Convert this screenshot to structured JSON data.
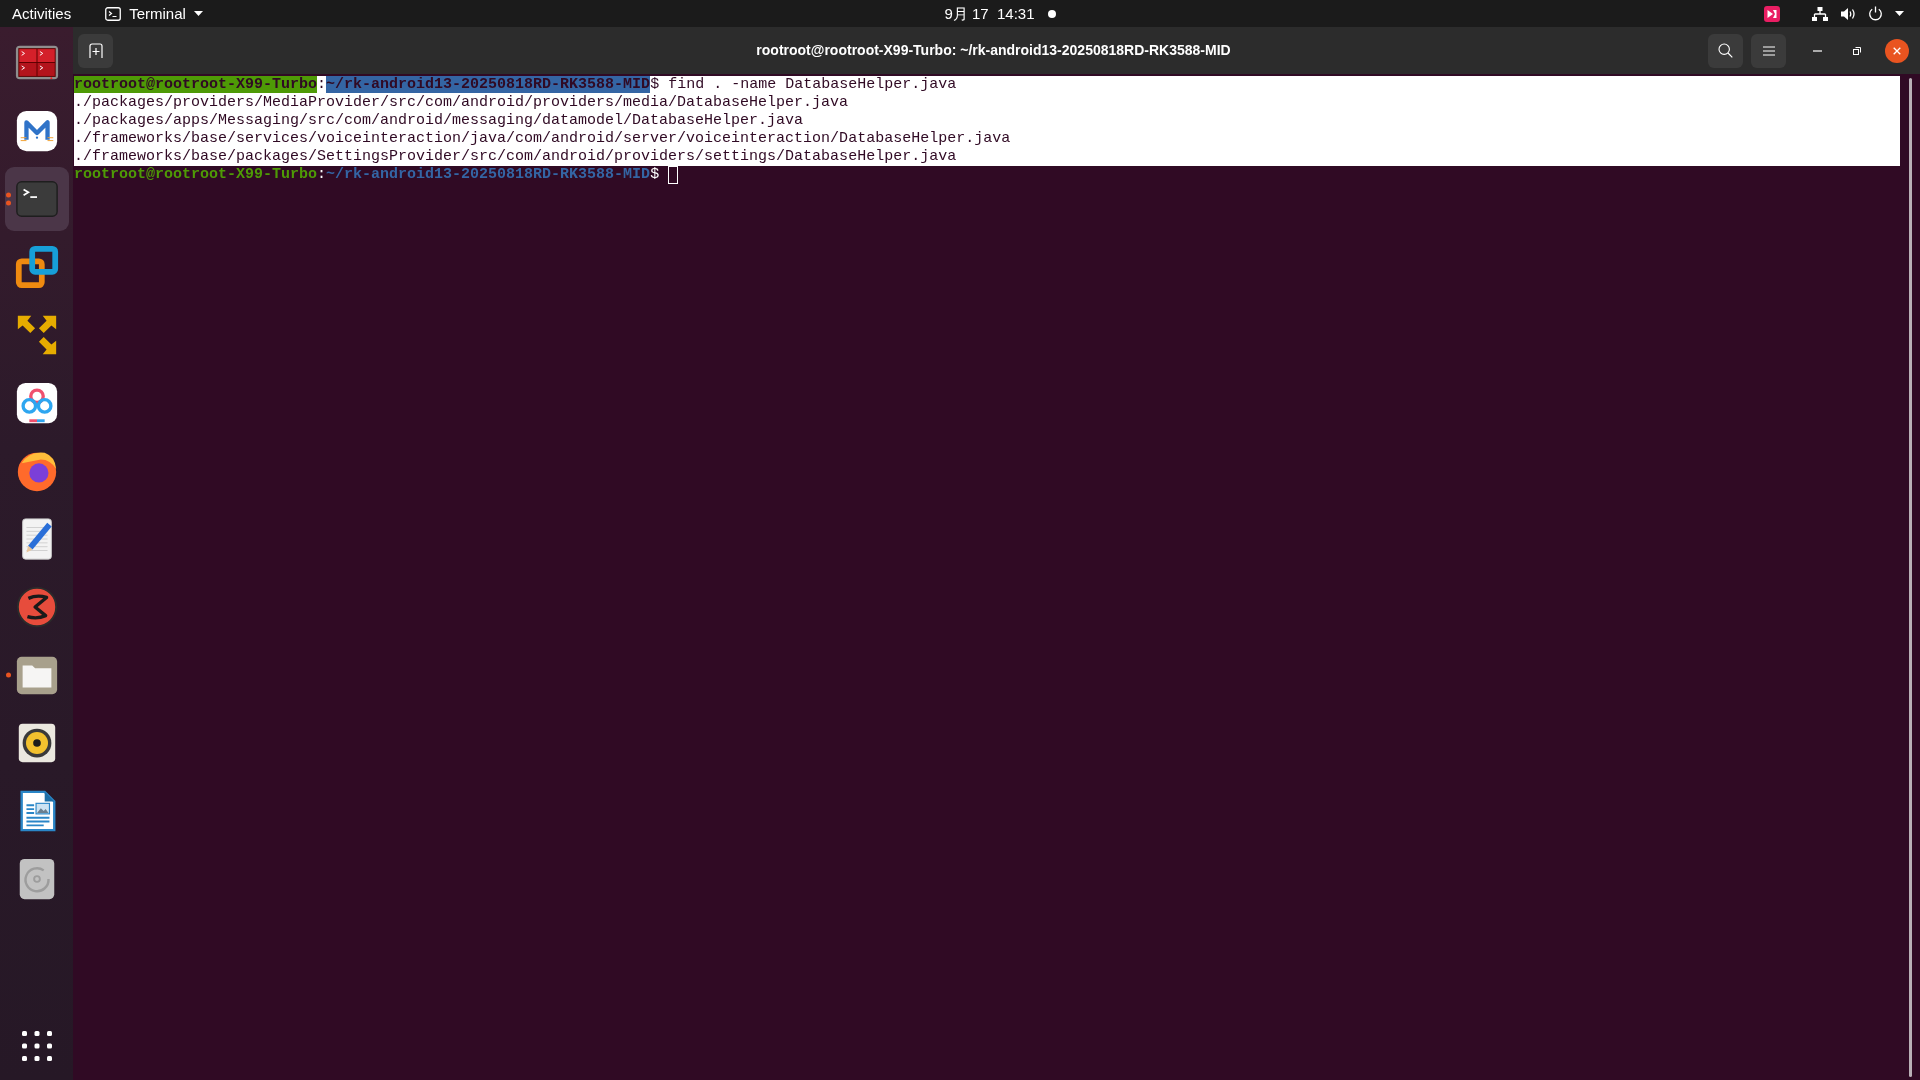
{
  "top_bar": {
    "activities": "Activities",
    "app_menu": "Terminal",
    "clock": "9月 17  14:31"
  },
  "dock": {
    "items": [
      {
        "kind": "terminals",
        "selected": false,
        "running": false,
        "several_windows": false
      },
      {
        "kind": "mail",
        "selected": false,
        "running": false,
        "several_windows": false
      },
      {
        "kind": "terminal",
        "selected": true,
        "running": true,
        "several_windows": true
      },
      {
        "kind": "squares",
        "selected": false,
        "running": false,
        "several_windows": false
      },
      {
        "kind": "arrows",
        "selected": false,
        "running": false,
        "several_windows": false
      },
      {
        "kind": "rings",
        "selected": false,
        "running": false,
        "several_windows": false
      },
      {
        "kind": "globe",
        "selected": false,
        "running": false,
        "several_windows": false
      },
      {
        "kind": "editor",
        "selected": false,
        "running": false,
        "several_windows": false
      },
      {
        "kind": "glyph",
        "selected": false,
        "running": false,
        "several_windows": false
      },
      {
        "kind": "folder",
        "selected": false,
        "running": true,
        "several_windows": false
      },
      {
        "kind": "speaker",
        "selected": false,
        "running": false,
        "several_windows": false
      },
      {
        "kind": "document",
        "selected": false,
        "running": false,
        "several_windows": false
      },
      {
        "kind": "disc",
        "selected": false,
        "running": false,
        "several_windows": false
      }
    ]
  },
  "window": {
    "title": "rootroot@rootroot-X99-Turbo: ~/rk-android13-20250818RD-RK3588-MID"
  },
  "terminal": {
    "lines": [
      {
        "selected": true,
        "cursor": false,
        "segments": [
          {
            "kind": "user",
            "text": "rootroot@rootroot-X99-Turbo"
          },
          {
            "kind": "plain",
            "text": ":"
          },
          {
            "kind": "path",
            "text": "~/rk-android13-20250818RD-RK3588-MID"
          },
          {
            "kind": "plain",
            "text": "$ find . -name DatabaseHelper.java"
          }
        ]
      },
      {
        "selected": true,
        "cursor": false,
        "segments": [
          {
            "kind": "plain",
            "text": "./packages/providers/MediaProvider/src/com/android/providers/media/DatabaseHelper.java"
          }
        ]
      },
      {
        "selected": true,
        "cursor": false,
        "segments": [
          {
            "kind": "plain",
            "text": "./packages/apps/Messaging/src/com/android/messaging/datamodel/DatabaseHelper.java"
          }
        ]
      },
      {
        "selected": true,
        "cursor": false,
        "segments": [
          {
            "kind": "plain",
            "text": "./frameworks/base/services/voiceinteraction/java/com/android/server/voiceinteraction/DatabaseHelper.java"
          }
        ]
      },
      {
        "selected": true,
        "cursor": false,
        "segments": [
          {
            "kind": "plain",
            "text": "./frameworks/base/packages/SettingsProvider/src/com/android/providers/settings/DatabaseHelper.java"
          }
        ]
      },
      {
        "selected": false,
        "cursor": true,
        "segments": [
          {
            "kind": "user",
            "text": "rootroot@rootroot-X99-Turbo"
          },
          {
            "kind": "plain",
            "text": ":"
          },
          {
            "kind": "path",
            "text": "~/rk-android13-20250818RD-RK3588-MID"
          },
          {
            "kind": "plain",
            "text": "$"
          }
        ]
      }
    ]
  }
}
